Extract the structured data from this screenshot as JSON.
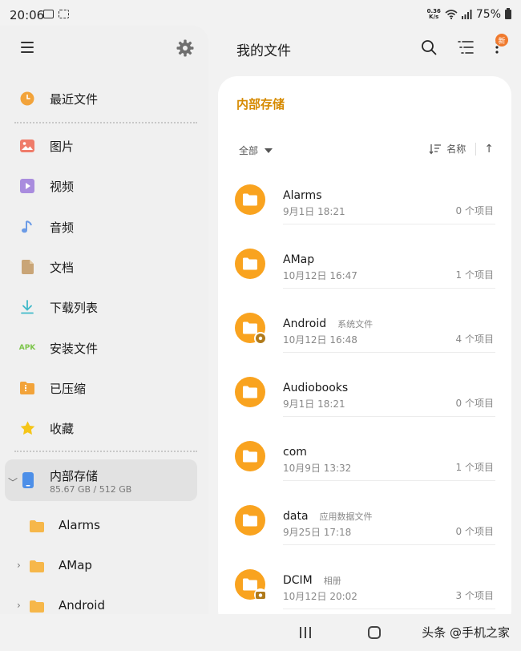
{
  "status_bar": {
    "time": "20:06",
    "network_speed_top": "0.36",
    "network_speed_bottom": "K/s",
    "battery": "75%"
  },
  "sidebar": {
    "items": [
      {
        "label": "最近文件",
        "icon": "clock-icon",
        "color": "#f2a33a"
      },
      {
        "label": "图片",
        "icon": "image-icon",
        "color": "#ef7c6a"
      },
      {
        "label": "视频",
        "icon": "video-icon",
        "color": "#a98cde"
      },
      {
        "label": "音频",
        "icon": "music-note-icon",
        "color": "#6b9be6"
      },
      {
        "label": "文档",
        "icon": "document-icon",
        "color": "#c9a577"
      },
      {
        "label": "下载列表",
        "icon": "download-icon",
        "color": "#3fb9c9"
      },
      {
        "label": "安装文件",
        "icon": "apk-icon",
        "icon_text": "APK",
        "color": "#7cc54a"
      },
      {
        "label": "已压缩",
        "icon": "archive-icon",
        "color": "#f2a33a"
      },
      {
        "label": "收藏",
        "icon": "star-icon",
        "color": "#f5c518"
      }
    ],
    "storage": {
      "label": "内部存储",
      "sub": "85.67 GB / 512 GB",
      "icon": "phone-icon",
      "color": "#4d8fe8"
    },
    "tree": [
      {
        "label": "Alarms",
        "has_children": false
      },
      {
        "label": "AMap",
        "has_children": true
      },
      {
        "label": "Android",
        "has_children": true
      }
    ]
  },
  "header": {
    "title": "我的文件",
    "badge": "新"
  },
  "panel": {
    "title": "内部存储",
    "filter_label": "全部",
    "sort_label": "名称",
    "sort_direction": "↑",
    "accent_color": "#f9a31f",
    "files": [
      {
        "name": "Alarms",
        "tag": "",
        "date": "9月1日 18:21",
        "count": "0 个项目",
        "overlay": ""
      },
      {
        "name": "AMap",
        "tag": "",
        "date": "10月12日 16:47",
        "count": "1 个项目",
        "overlay": ""
      },
      {
        "name": "Android",
        "tag": "系统文件",
        "date": "10月12日 16:48",
        "count": "4 个项目",
        "overlay": "gear"
      },
      {
        "name": "Audiobooks",
        "tag": "",
        "date": "9月1日 18:21",
        "count": "0 个项目",
        "overlay": ""
      },
      {
        "name": "com",
        "tag": "",
        "date": "10月9日 13:32",
        "count": "1 个项目",
        "overlay": ""
      },
      {
        "name": "data",
        "tag": "应用数据文件",
        "date": "9月25日 17:18",
        "count": "0 个项目",
        "overlay": ""
      },
      {
        "name": "DCIM",
        "tag": "相册",
        "date": "10月12日 20:02",
        "count": "3 个项目",
        "overlay": "camera"
      }
    ]
  },
  "watermark": "头条 @手机之家"
}
